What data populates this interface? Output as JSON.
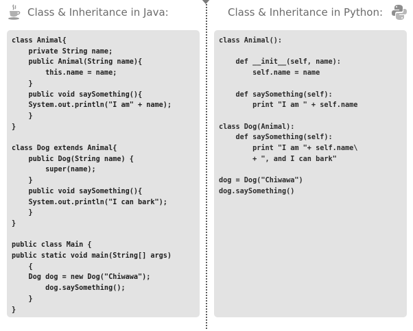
{
  "java": {
    "title": "Class & Inheritance in Java:",
    "icon": "java-coffee-cup-icon",
    "code": "class Animal{\n    private String name;\n    public Animal(String name){\n        this.name = name;\n    }\n    public void saySomething(){\n    System.out.println(\"I am\" + name);\n    }\n}\n\nclass Dog extends Animal{\n    public Dog(String name) {\n        super(name);\n    }\n    public void saySomething(){\n    System.out.println(\"I can bark\");\n    }\n}\n\npublic class Main {\npublic static void main(String[] args)\n    {\n    Dog dog = new Dog(\"Chiwawa\");\n        dog.saySomething();\n    }\n}"
  },
  "python": {
    "title": "Class & Inheritance in Python:",
    "icon": "python-logo-icon",
    "code": "class Animal():\n\n    def __init__(self, name):\n        self.name = name\n\n    def saySomething(self):\n        print \"I am \" + self.name\n\nclass Dog(Animal):\n    def saySomething(self):\n        print \"I am \"+ self.name\\\n        + \", and I can bark\"\n\ndog = Dog(\"Chiwawa\")\ndog.saySomething()"
  },
  "colors": {
    "code_background": "#e3e3e3",
    "title_text": "#6b6b6b",
    "divider": "#5a5a5a"
  }
}
